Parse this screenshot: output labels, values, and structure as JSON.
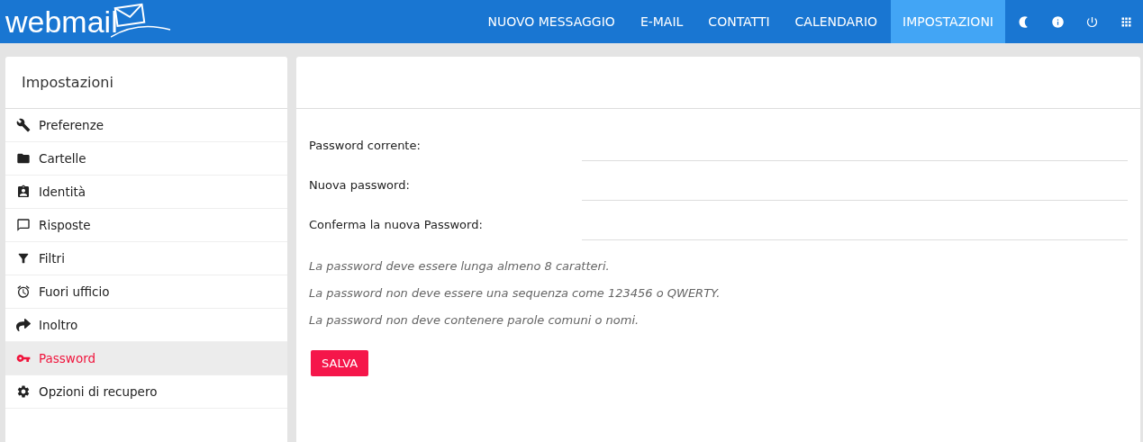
{
  "header": {
    "logo": "webmail",
    "nav": [
      {
        "label": "NUOVO MESSAGGIO",
        "selected": false
      },
      {
        "label": "E-MAIL",
        "selected": false
      },
      {
        "label": "CONTATTI",
        "selected": false
      },
      {
        "label": "CALENDARIO",
        "selected": false
      },
      {
        "label": "IMPOSTAZIONI",
        "selected": true
      }
    ]
  },
  "sidebar": {
    "title": "Impostazioni",
    "items": [
      {
        "label": "Preferenze",
        "selected": false
      },
      {
        "label": "Cartelle",
        "selected": false
      },
      {
        "label": "Identità",
        "selected": false
      },
      {
        "label": "Risposte",
        "selected": false
      },
      {
        "label": "Filtri",
        "selected": false
      },
      {
        "label": "Fuori ufficio",
        "selected": false
      },
      {
        "label": "Inoltro",
        "selected": false
      },
      {
        "label": "Password",
        "selected": true
      },
      {
        "label": "Opzioni di recupero",
        "selected": false
      }
    ]
  },
  "form": {
    "fields": [
      {
        "label": "Password corrente:"
      },
      {
        "label": "Nuova password:"
      },
      {
        "label": "Conferma la nuova Password:"
      }
    ],
    "hints": [
      "La password deve essere lunga almeno 8 caratteri.",
      "La password non deve essere una sequenza come 123456 o QWERTY.",
      "La password non deve contenere parole comuni o nomi."
    ],
    "save_button": "SALVA"
  }
}
